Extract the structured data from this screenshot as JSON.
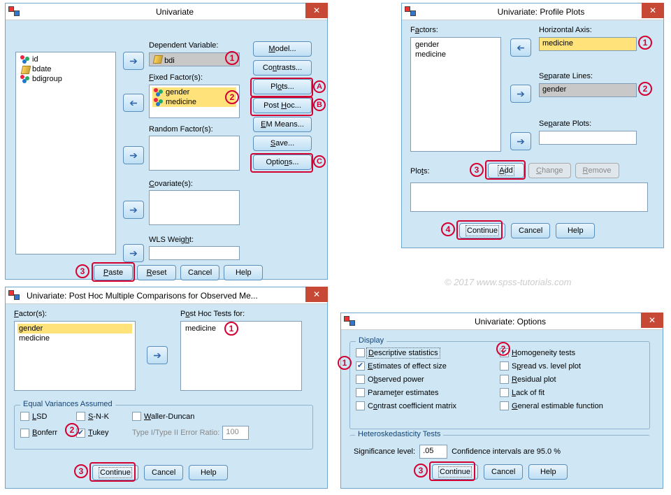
{
  "w1": {
    "title": "Univariate",
    "vars": [
      "id",
      "bdate",
      "bdigroup"
    ],
    "dep_label": "Dependent Variable:",
    "dep_value": "bdi",
    "fixed_label": "Fixed Factor(s):",
    "fixed_values": [
      "gender",
      "medicine"
    ],
    "random_label": "Random Factor(s):",
    "cov_label": "Covariate(s):",
    "wls_label": "WLS Weight:",
    "btns": {
      "model": "Model...",
      "contrasts": "Contrasts...",
      "plots": "Plots...",
      "posthoc": "Post Hoc...",
      "emmeans": "EM Means...",
      "save": "Save...",
      "options": "Options..."
    },
    "bottom": {
      "paste": "Paste",
      "reset": "Reset",
      "cancel": "Cancel",
      "help": "Help"
    }
  },
  "w2": {
    "title": "Univariate: Profile Plots",
    "factors_label": "Factors:",
    "factors": [
      "gender",
      "medicine"
    ],
    "haxis_label": "Horizontal Axis:",
    "haxis_value": "medicine",
    "seplines_label": "Separate Lines:",
    "seplines_value": "gender",
    "sepplots_label": "Separate Plots:",
    "plots_label": "Plots:",
    "add": "Add",
    "change": "Change",
    "remove": "Remove",
    "continue": "Continue",
    "cancel": "Cancel",
    "help": "Help"
  },
  "w3": {
    "title": "Univariate: Post Hoc Multiple Comparisons for Observed Me...",
    "factors_label": "Factor(s):",
    "factors": [
      "gender",
      "medicine"
    ],
    "posthoc_label": "Post Hoc Tests for:",
    "posthoc_values": [
      "medicine"
    ],
    "eqvar_label": "Equal Variances Assumed",
    "lsd": "LSD",
    "snk": "S-N-K",
    "waller": "Waller-Duncan",
    "bonferroni": "Bonferroni",
    "tukey": "Tukey",
    "ratio_label": "Type I/Type II Error Ratio:",
    "ratio_value": "100",
    "continue": "Continue",
    "cancel": "Cancel",
    "help": "Help"
  },
  "w4": {
    "title": "Univariate: Options",
    "display_label": "Display",
    "opt": {
      "desc": "Descriptive statistics",
      "effect": "Estimates of effect size",
      "obs": "Observed power",
      "param": "Parameter estimates",
      "ccm": "Contrast coefficient matrix",
      "homo": "Homogeneity tests",
      "spread": "Spread vs. level plot",
      "resid": "Residual plot",
      "lack": "Lack of fit",
      "gef": "General estimable function"
    },
    "hetero_label": "Heteroskedasticity Tests",
    "sig_label": "Significance level:",
    "sig_value": ".05",
    "ci_text": "Confidence intervals are 95.0 %",
    "continue": "Continue",
    "cancel": "Cancel",
    "help": "Help"
  },
  "watermark": "© 2017 www.spss-tutorials.com"
}
